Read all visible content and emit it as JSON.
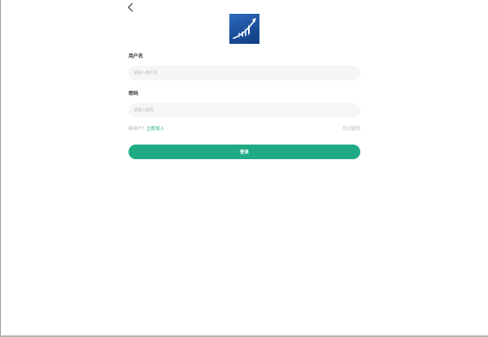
{
  "back": {
    "icon": "chevron-left-icon"
  },
  "logo": {
    "icon": "growth-chart-logo-icon",
    "bg": "#1b4f9a"
  },
  "form": {
    "username_label": "用户名",
    "username_placeholder": "请输入用户名",
    "password_label": "密码",
    "password_placeholder": "请输入密码"
  },
  "links": {
    "new_user_prefix": "新用户？",
    "join": "立即加入",
    "forgot": "忘记密码"
  },
  "login_button": "登录",
  "colors": {
    "accent": "#1faa85",
    "input_bg": "#f6f6f6"
  }
}
